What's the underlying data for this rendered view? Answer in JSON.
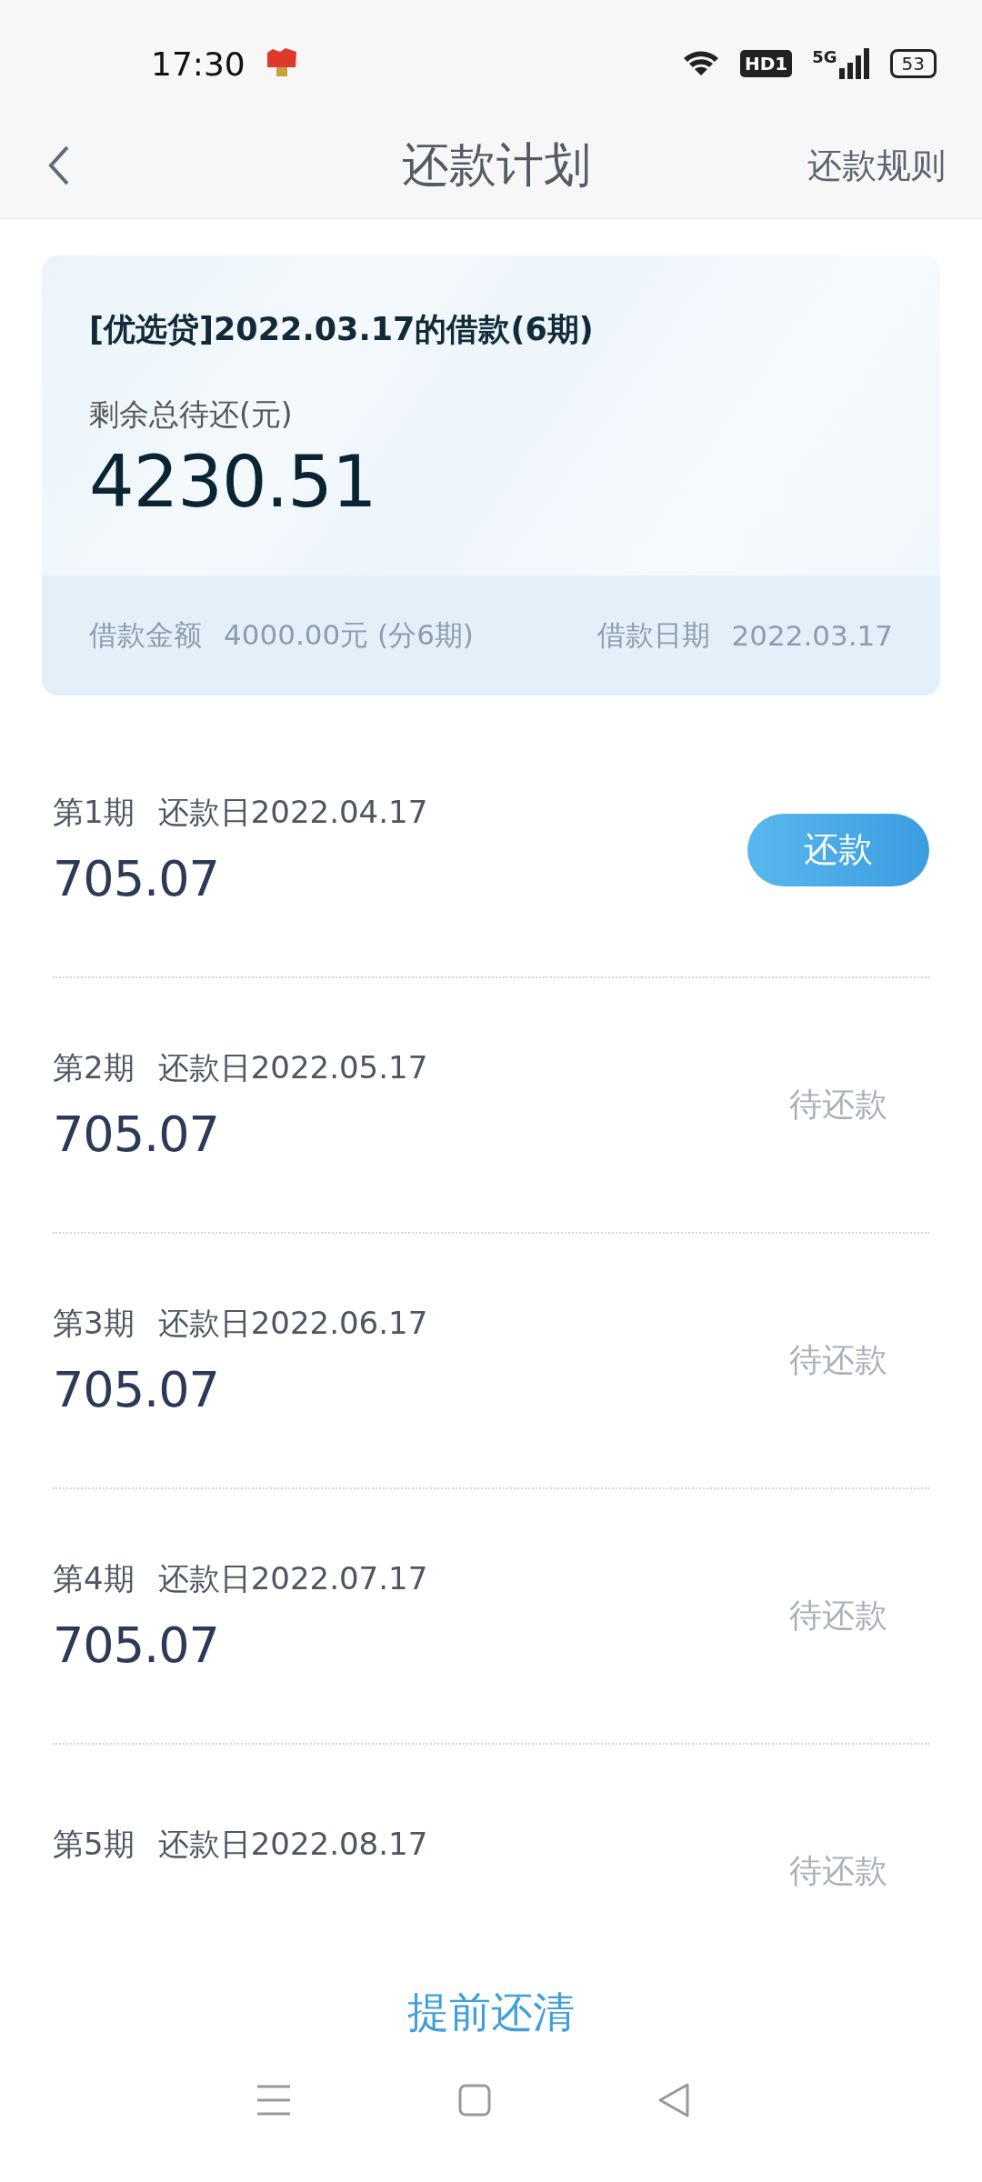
{
  "status_bar": {
    "time": "17:30",
    "hd": "HD1",
    "network": "5G",
    "battery": "53"
  },
  "header": {
    "title": "还款计划",
    "action": "还款规则"
  },
  "loan_card": {
    "title": "[优选贷]2022.03.17的借款(6期)",
    "remaining_label": "剩余总待还(元)",
    "remaining_amount": "4230.51",
    "amount_label": "借款金额",
    "amount_value": "4000.00元 (分6期)",
    "date_label": "借款日期",
    "date_value": "2022.03.17"
  },
  "installments": [
    {
      "period": "第1期",
      "due": "还款日2022.04.17",
      "amount": "705.07",
      "kind": "button",
      "status": "还款"
    },
    {
      "period": "第2期",
      "due": "还款日2022.05.17",
      "amount": "705.07",
      "kind": "pending",
      "status": "待还款"
    },
    {
      "period": "第3期",
      "due": "还款日2022.06.17",
      "amount": "705.07",
      "kind": "pending",
      "status": "待还款"
    },
    {
      "period": "第4期",
      "due": "还款日2022.07.17",
      "amount": "705.07",
      "kind": "pending",
      "status": "待还款"
    },
    {
      "period": "第5期",
      "due": "还款日2022.08.17",
      "kind": "pending",
      "status": "待还款"
    }
  ],
  "payoff_button": "提前还清"
}
